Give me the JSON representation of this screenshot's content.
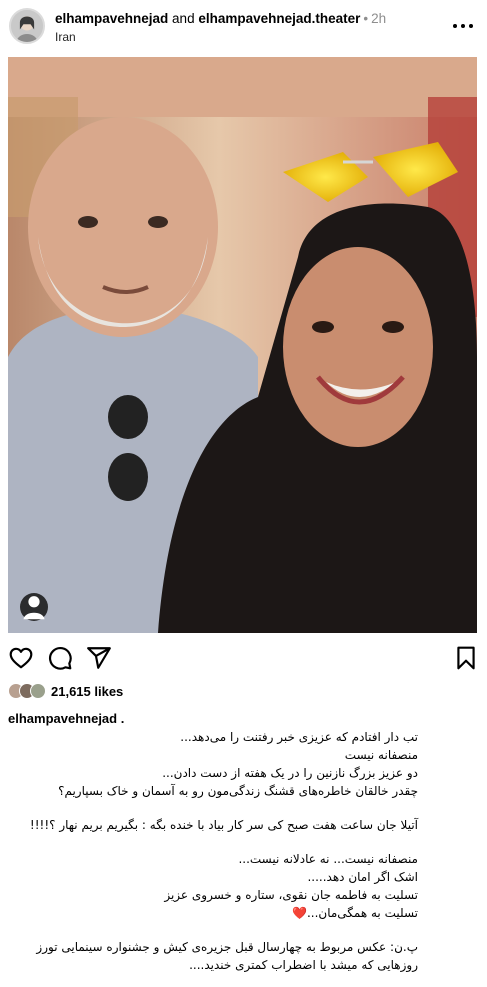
{
  "post": {
    "author": "elhampavehnejad",
    "and_text": " and ",
    "coauthor": "elhampavehnejad.theater",
    "separator": "•",
    "time": "2h",
    "location": "Iran"
  },
  "icons": {
    "more": "more-options-icon",
    "tag": "user-tag-icon",
    "like": "heart-icon",
    "comment": "comment-icon",
    "share": "share-icon",
    "save": "bookmark-icon"
  },
  "likes": {
    "count_text": "21,615 likes"
  },
  "caption": {
    "username": "elhampavehnejad .",
    "lines": [
      "تب دار افتادم که عزیزی خبر رفتنت را می‌دهد...",
      "منصفانه نیست",
      "دو عزیز بزرگ نازنین را در یک هفته از دست دادن...",
      "چقدر خالقان خاطره‌های قشنگ زندگی‌مون رو به آسمان و خاک بسپاریم؟",
      "آتیلا جان ساعت هفت صبح کی سر کار بیاد با خنده بگه : بگیریم بریم نهار ؟!!!!",
      "منصفانه نیست... نه عادلانه نیست...",
      "اشک اگر امان دهد.....",
      "تسلیت به فاطمه جان نقوی، ستاره و خسروی عزیز",
      "تسلیت به همگی‌مان...",
      "پ.ن: عکس مربوط به چهارسال قبل جزیره‌ی کیش و جشنواره سینمایی تورز",
      "روزهایی که میشد با اضطراب کمتری خندید...."
    ],
    "heart_emoji": "❤️"
  },
  "colors": {
    "heart": "#d81e32",
    "muted": "#8e8e8e",
    "text": "#000000"
  }
}
